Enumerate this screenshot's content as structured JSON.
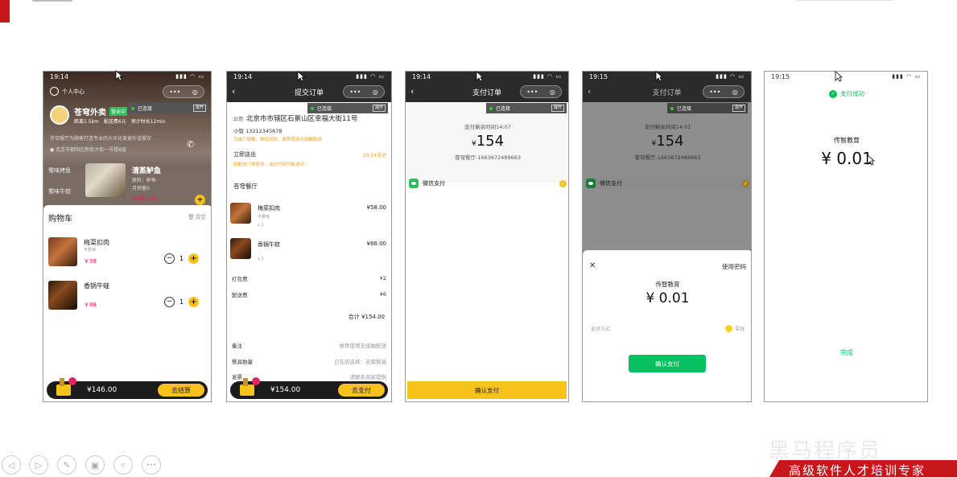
{
  "colors": {
    "accent": "#f7c21b",
    "wechat_green": "#2ebd59",
    "price_red": "#e0245e",
    "brand_red": "#c8161d"
  },
  "common": {
    "connected": "已连接",
    "expand": "展开",
    "capsule_more": "•••",
    "capsule_close": "◎",
    "back": "‹"
  },
  "phone1": {
    "time": "19:14",
    "user_center": "个人中心",
    "shop_name": "苍穹外卖",
    "shop_status": "营业中",
    "distance": "距离1.5km",
    "delivery_fee": "配送费6元",
    "estimated": "预计时长12min",
    "desc": "苍穹餐厅为顾客打造专业的大众化美食外送餐饮",
    "address": "北京市朝阳区新街大街一号楼8层",
    "cat1": "蜀味烤鱼",
    "cat2": "蜀味牛蛙",
    "dish_name": "清蒸鲈鱼",
    "dish_material": "原料：鲈鱼",
    "dish_sales": "月销量0",
    "dish_price": "¥98.00",
    "cart_title": "购物车",
    "clear": "清空",
    "items": [
      {
        "name": "梅菜扣肉",
        "tag": "不要辣",
        "price": "￥58",
        "qty": "1"
      },
      {
        "name": "香锅牛蛙",
        "tag": "",
        "price": "￥88",
        "qty": "1"
      }
    ],
    "total": "¥146.00",
    "checkout": "去结算"
  },
  "phone2": {
    "time": "19:14",
    "title": "提交订单",
    "addr_tag": "公司",
    "address": "北京市市辖区石景山区幸福大街11号",
    "contact": "小智 13212345678",
    "tip": "为减少接触，降低风险，推荐使用无接触配送",
    "deliver_now": "立即送出",
    "deliver_time": "20:14送达",
    "deliver_note": "因配送订单较多，送达时间可能波动",
    "restaurant": "苍穹餐厅",
    "items": [
      {
        "name": "梅菜扣肉",
        "tag": "不要辣",
        "qty": "x 1",
        "price": "¥58.00"
      },
      {
        "name": "香锅牛蛙",
        "tag": "",
        "qty": "x 1",
        "price": "¥88.00"
      }
    ],
    "pack_label": "打包费",
    "pack_value": "¥2",
    "ship_label": "配送费",
    "ship_value": "¥6",
    "subtotal": "合计 ¥154.00",
    "remark_label": "备注",
    "remark_value": "推荐使用无接触配送",
    "tableware_label": "餐具数量",
    "tableware_value": "已在店选择：无需餐具",
    "invoice_label": "发票",
    "invoice_value": "请联系商家提供",
    "total": "¥154.00",
    "pay": "去支付"
  },
  "phone3": {
    "time": "19:14",
    "title": "支付订单",
    "remaining": "支付剩余时间14:07",
    "currency": "¥",
    "amount": "154",
    "order_no": "苍穹餐厅-1663672489663",
    "method": "微信支付",
    "confirm": "确认支付"
  },
  "phone4": {
    "time": "19:15",
    "title": "支付订单",
    "remaining": "支付剩余时间14:01",
    "currency": "¥",
    "amount": "154",
    "order_no": "苍穹餐厅-1663672489663",
    "method": "微信支付",
    "close": "✕",
    "use_password": "使用密码",
    "payee": "传智教育",
    "pay_amount": "¥ 0.01",
    "pay_method_label": "支付方式",
    "pay_method_value": "零钱",
    "confirm": "确认支付"
  },
  "phone5": {
    "time": "19:15",
    "success": "支付成功",
    "payee": "传智教育",
    "amount": "¥ 0.01",
    "done": "完成"
  },
  "footer": {
    "banner": "高级软件人才培训专家",
    "watermark": "黑马程序员"
  },
  "controls": [
    "◁",
    "▷",
    "✎",
    "▣",
    "⌕",
    "•••"
  ]
}
